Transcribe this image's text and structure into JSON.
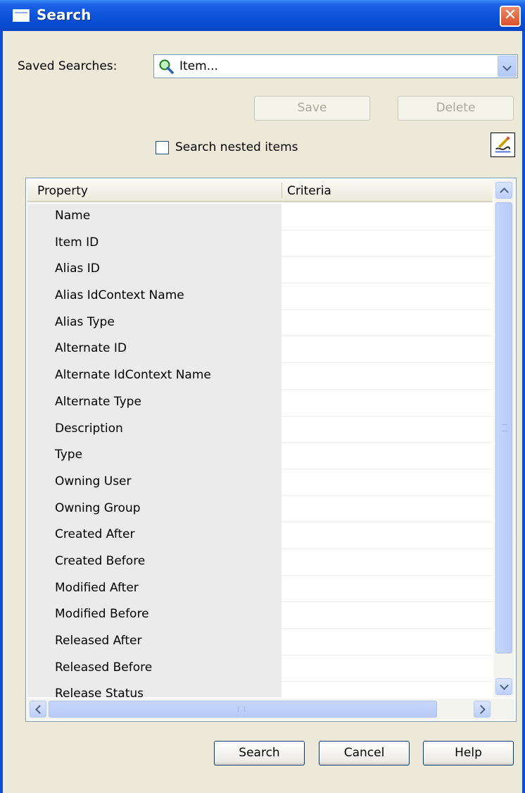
{
  "window": {
    "title": "Search",
    "close_glyph": "✕"
  },
  "saved_searches": {
    "label": "Saved Searches:",
    "value": "Item...",
    "icon": "search-icon"
  },
  "buttons": {
    "save": "Save",
    "delete": "Delete",
    "search": "Search",
    "cancel": "Cancel",
    "help": "Help"
  },
  "nested": {
    "label": "Search nested items",
    "checked": false
  },
  "edit_icon": "edit-criteria-icon",
  "grid": {
    "headers": {
      "property": "Property",
      "criteria": "Criteria"
    },
    "rows": [
      "Name",
      "Item ID",
      "Alias ID",
      "Alias IdContext Name",
      "Alias Type",
      "Alternate ID",
      "Alternate IdContext Name",
      "Alternate Type",
      "Description",
      "Type",
      "Owning User",
      "Owning Group",
      "Created After",
      "Created Before",
      "Modified After",
      "Modified Before",
      "Released After",
      "Released Before",
      "Release Status"
    ]
  },
  "colors": {
    "titlebar": "#0a50d8",
    "dialog_bg": "#ece9d8",
    "property_bg": "#ebebeb"
  }
}
